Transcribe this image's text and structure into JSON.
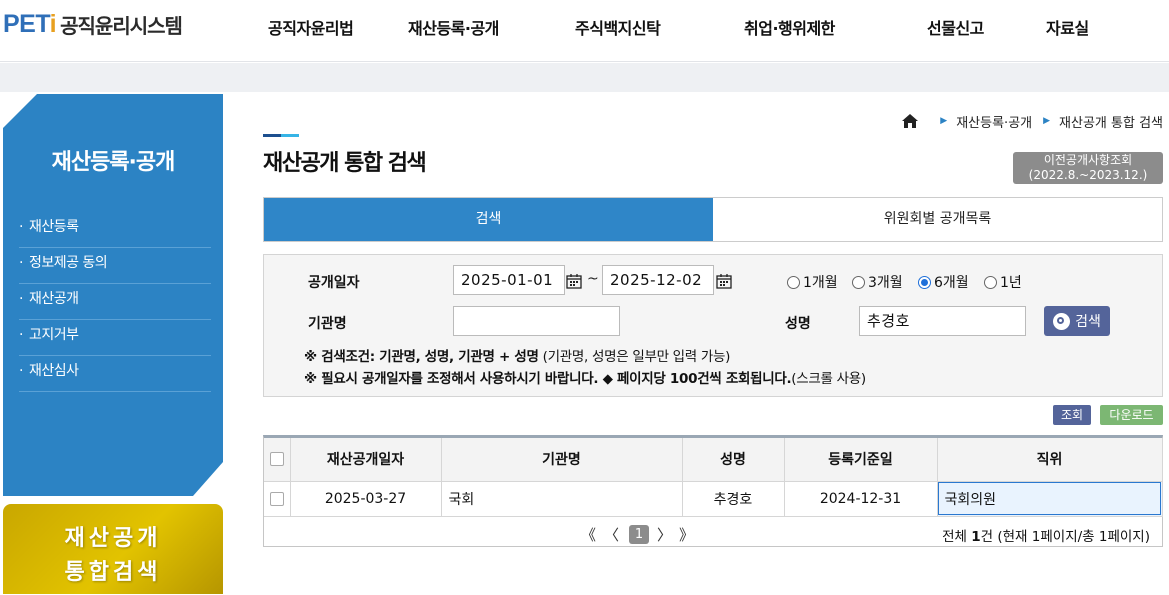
{
  "header": {
    "logo_brand": "PETi",
    "logo_text": "공직윤리시스템",
    "nav": [
      "공직자윤리법",
      "재산등록·공개",
      "주식백지신탁",
      "취업·행위제한",
      "선물신고",
      "자료실"
    ]
  },
  "sidebar": {
    "title": "재산등록·공개",
    "items": [
      "재산등록",
      "정보제공 동의",
      "재산공개",
      "고지거부",
      "재산심사"
    ]
  },
  "banner": {
    "line1": "재산공개",
    "line2": "통합검색"
  },
  "breadcrumb": {
    "items": [
      "재산등록·공개",
      "재산공개 통합 검색"
    ]
  },
  "page": {
    "title": "재산공개 통합 검색",
    "prev_button_line1": "이전공개사항조회",
    "prev_button_line2": "(2022.8.~2023.12.)"
  },
  "tabs": [
    {
      "label": "검색",
      "active": true
    },
    {
      "label": "위원회별 공개목록",
      "active": false
    }
  ],
  "search": {
    "date_label": "공개일자",
    "date_from": "2025-01-01",
    "date_to": "2025-12-02",
    "range_sep": "~",
    "periods": [
      {
        "label": "1개월",
        "selected": false
      },
      {
        "label": "3개월",
        "selected": false
      },
      {
        "label": "6개월",
        "selected": true
      },
      {
        "label": "1년",
        "selected": false
      }
    ],
    "org_label": "기관명",
    "org_value": "",
    "name_label": "성명",
    "name_value": "추경호",
    "search_button": "검색",
    "note1_bold": "※ 검색조건: 기관명, 성명, 기관명 + 성명",
    "note1_rest": " (기관명, 성명은 일부만 입력 가능)",
    "note2_bold": "※ 필요시 공개일자를 조정해서 사용하시기 바랍니다. ◆ 페이지당 100건씩 조회됩니다.",
    "note2_rest": "(스크롤 사용)"
  },
  "actions": {
    "view": "조회",
    "download": "다운로드"
  },
  "table": {
    "headers": [
      "재산공개일자",
      "기관명",
      "성명",
      "등록기준일",
      "직위"
    ],
    "rows": [
      [
        "2025-03-27",
        "국회",
        "추경호",
        "2024-12-31",
        "국회의원"
      ]
    ]
  },
  "pager": {
    "first": "《",
    "prev": "〈",
    "current": "1",
    "next": "〉",
    "last": "》",
    "info_prefix": "전체 ",
    "info_count": "1",
    "info_suffix": "건 (현재 1페이지/총 1페이지)"
  },
  "colors": {
    "primary": "#2f86c8",
    "sidebar": "#2c83c4",
    "banner": "#d4b400",
    "search_button": "#54649a",
    "download": "#7cb773"
  }
}
